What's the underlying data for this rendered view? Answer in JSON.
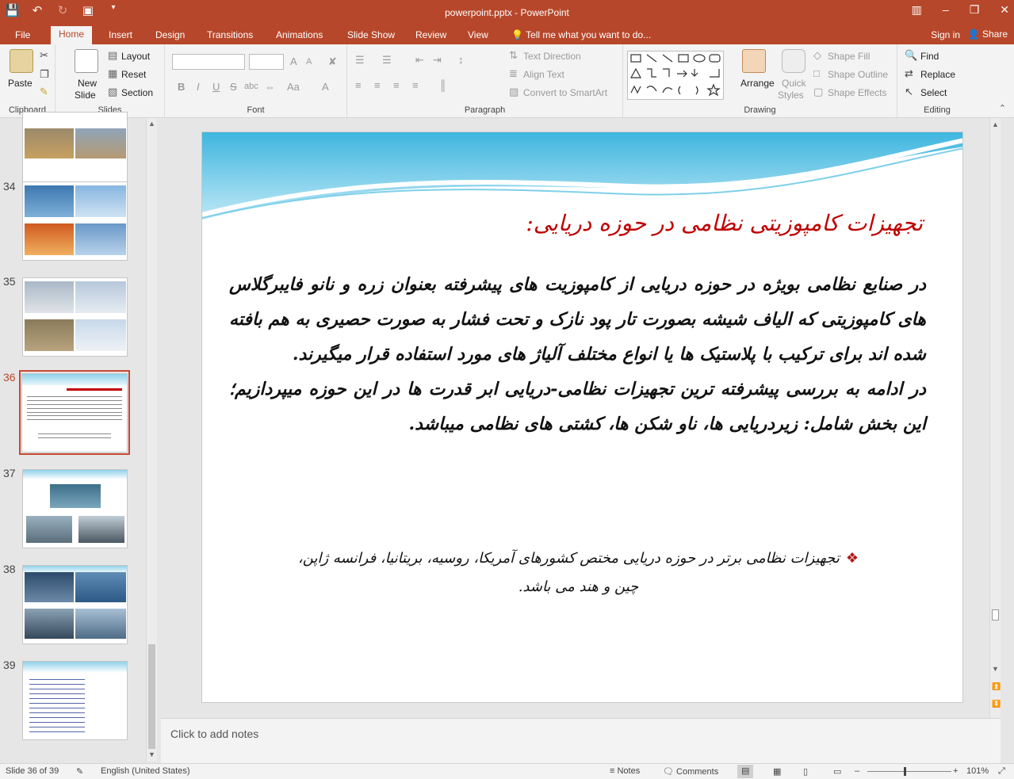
{
  "window": {
    "title": "powerpoint.pptx - PowerPoint",
    "accent": "#b7472a"
  },
  "quick_access": [
    "save-icon",
    "undo-icon",
    "redo-icon",
    "start-from-beginning-icon",
    "customize-icon"
  ],
  "tabs": [
    {
      "label": "File"
    },
    {
      "label": "Home",
      "active": true
    },
    {
      "label": "Insert"
    },
    {
      "label": "Design"
    },
    {
      "label": "Transitions"
    },
    {
      "label": "Animations"
    },
    {
      "label": "Slide Show"
    },
    {
      "label": "Review"
    },
    {
      "label": "View"
    },
    {
      "label": "Tell me what you want to do..."
    }
  ],
  "account": {
    "signin": "Sign in",
    "share": "Share"
  },
  "ribbon": {
    "clipboard": {
      "paste": "Paste",
      "label": "Clipboard"
    },
    "slides": {
      "new_slide_1": "New",
      "new_slide_2": "Slide",
      "layout": "Layout",
      "reset": "Reset",
      "section": "Section",
      "label": "Slides"
    },
    "font": {
      "bold": "B",
      "italic": "I",
      "underline": "U",
      "strike": "S",
      "spacing": "abc",
      "size_up": "A",
      "size_down": "A",
      "case": "Aa",
      "clear": "A",
      "label": "Font"
    },
    "paragraph": {
      "text_direction": "Text Direction",
      "align_text": "Align Text",
      "smartart": "Convert to SmartArt",
      "label": "Paragraph"
    },
    "drawing": {
      "arrange": "Arrange",
      "quick_styles_1": "Quick",
      "quick_styles_2": "Styles",
      "shape_fill": "Shape Fill",
      "shape_outline": "Shape Outline",
      "shape_effects": "Shape Effects",
      "label": "Drawing"
    },
    "editing": {
      "find": "Find",
      "replace": "Replace",
      "select": "Select",
      "label": "Editing"
    }
  },
  "thumbnails": [
    {
      "num": "",
      "kind": "photos"
    },
    {
      "num": "34",
      "kind": "photos"
    },
    {
      "num": "35",
      "kind": "photos"
    },
    {
      "num": "36",
      "kind": "text",
      "selected": true
    },
    {
      "num": "37",
      "kind": "photos"
    },
    {
      "num": "38",
      "kind": "photos"
    },
    {
      "num": "39",
      "kind": "list"
    }
  ],
  "slide": {
    "title": "تجهیزات کامپوزیتی نظامی در حوزه دریایی:",
    "paragraph1": "در صنایع نظامی بویژه در حوزه دریایی از کامپوزیت های پیشرفته بعنوان زره و نانو فایبرگلاس های کامپوزیتی که الیاف شیشه بصورت تار پود نازک و تحت فشار به صورت حصیری به هم بافته شده اند برای  ترکیب با پلاستیک ها یا انواع مختلف آلیاژ های مورد استفاده قرار میگیرند.",
    "paragraph2": "در ادامه به بررسی پیشرفته ترین تجهیزات نظامی-دریایی ابر قدرت ها در این حوزه میپردازیم؛ این بخش شامل: زیردریایی ها، ناو شکن ها، کشتی های نظامی میباشد.",
    "bullet": "تجهیزات نظامی برتر در حوزه دریایی مختص کشورهای آمریکا، روسیه، بریتانیا، فرانسه ژاپن، چین و هند می باشد.",
    "title_color": "#c00000",
    "bullet_color": "#b01a1a"
  },
  "notes": {
    "placeholder": "Click to add notes"
  },
  "status": {
    "slide_info": "Slide 36 of 39",
    "language": "English (United States)",
    "notes": "Notes",
    "comments": "Comments",
    "zoom": "101%"
  }
}
